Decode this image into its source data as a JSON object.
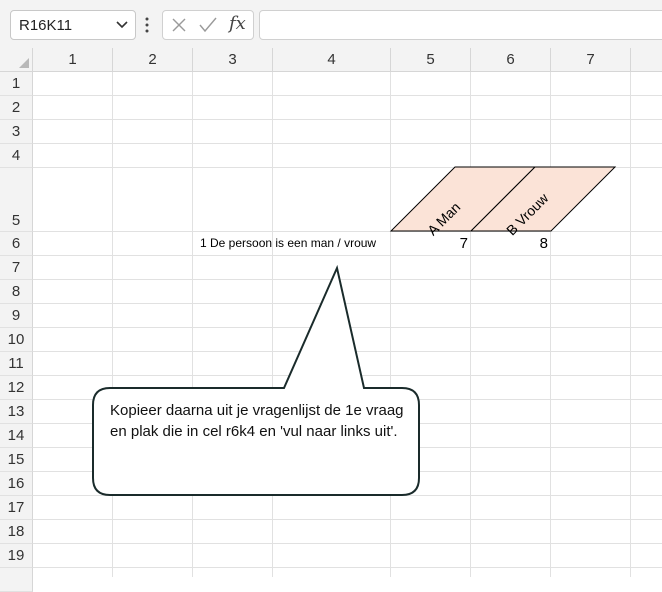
{
  "formula_bar": {
    "name_box": "R16K11",
    "formula": "",
    "insert_function_label": "fx"
  },
  "columns": [
    "1",
    "2",
    "3",
    "4",
    "5",
    "6",
    "7"
  ],
  "rows": [
    "1",
    "2",
    "3",
    "4",
    "5",
    "6",
    "7",
    "8",
    "9",
    "10",
    "11",
    "12",
    "13",
    "14",
    "15",
    "16",
    "17",
    "18",
    "19"
  ],
  "cells": {
    "r6k4": "1 De persoon is een man / vrouw",
    "r6k5": "7",
    "r6k6": "8",
    "r5k5": "A Man",
    "r5k6": "B Vrouw"
  },
  "callout": {
    "text": "Kopieer daarna uit je vragenlijst de 1e vraag en plak die in cel r6k4 en 'vul naar links uit'."
  },
  "colors": {
    "header_bg": "#f3f3f3",
    "gridline": "#e1e1e1",
    "diagonal_fill": "#fbe3d7",
    "callout_border": "#1a2b2b"
  },
  "icons": {
    "name_box_dropdown": "chevron-down-icon",
    "cancel": "x-icon",
    "enter": "check-icon",
    "grip": "vertical-dots-icon",
    "corner": "select-all-triangle-icon"
  }
}
